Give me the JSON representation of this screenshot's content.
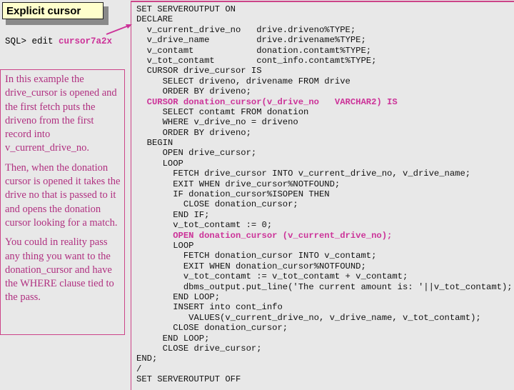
{
  "title": "Explicit cursor",
  "sql_command": {
    "prompt": "SQL> edit ",
    "file": "cursor7a2x"
  },
  "colors": {
    "accent": "#cc3399",
    "border": "#cc4488",
    "title_bg": "#ffffcc",
    "background": "#e8e8e8"
  },
  "explanation": [
    "In this example the drive_cursor is opened and the first fetch puts the driveno from the first record into v_current_drive_no.",
    "Then, when the donation cursor is opened it takes the drive no that is passed to it and opens the donation cursor looking for a match.",
    "You could in reality pass any thing you want to the donation_cursor and have the WHERE clause tied to the pass."
  ],
  "code_lines": [
    {
      "text": "SET SERVEROUTPUT ON",
      "highlight": false
    },
    {
      "text": "DECLARE",
      "highlight": false
    },
    {
      "text": "  v_current_drive_no   drive.driveno%TYPE;",
      "highlight": false
    },
    {
      "text": "  v_drive_name         drive.drivename%TYPE;",
      "highlight": false
    },
    {
      "text": "  v_contamt            donation.contamt%TYPE;",
      "highlight": false
    },
    {
      "text": "  v_tot_contamt        cont_info.contamt%TYPE;",
      "highlight": false
    },
    {
      "text": "  CURSOR drive_cursor IS",
      "highlight": false
    },
    {
      "text": "     SELECT driveno, drivename FROM drive",
      "highlight": false
    },
    {
      "text": "     ORDER BY driveno;",
      "highlight": false
    },
    {
      "text": "  CURSOR donation_cursor(v_drive_no   VARCHAR2) IS",
      "highlight": true
    },
    {
      "text": "     SELECT contamt FROM donation",
      "highlight": false
    },
    {
      "text": "     WHERE v_drive_no = driveno",
      "highlight": false
    },
    {
      "text": "     ORDER BY driveno;",
      "highlight": false
    },
    {
      "text": "  BEGIN",
      "highlight": false
    },
    {
      "text": "     OPEN drive_cursor;",
      "highlight": false
    },
    {
      "text": "     LOOP",
      "highlight": false
    },
    {
      "text": "       FETCH drive_cursor INTO v_current_drive_no, v_drive_name;",
      "highlight": false
    },
    {
      "text": "       EXIT WHEN drive_cursor%NOTFOUND;",
      "highlight": false
    },
    {
      "text": "       IF donation_cursor%ISOPEN THEN",
      "highlight": false
    },
    {
      "text": "         CLOSE donation_cursor;",
      "highlight": false
    },
    {
      "text": "       END IF;",
      "highlight": false
    },
    {
      "text": "       v_tot_contamt := 0;",
      "highlight": false
    },
    {
      "text": "       OPEN donation_cursor (v_current_drive_no);",
      "highlight": true
    },
    {
      "text": "       LOOP",
      "highlight": false
    },
    {
      "text": "         FETCH donation_cursor INTO v_contamt;",
      "highlight": false
    },
    {
      "text": "         EXIT WHEN donation_cursor%NOTFOUND;",
      "highlight": false
    },
    {
      "text": "         v_tot_contamt := v_tot_contamt + v_contamt;",
      "highlight": false
    },
    {
      "text": "         dbms_output.put_line('The current amount is: '||v_tot_contamt);",
      "highlight": false
    },
    {
      "text": "       END LOOP;",
      "highlight": false
    },
    {
      "text": "       INSERT into cont_info",
      "highlight": false
    },
    {
      "text": "          VALUES(v_current_drive_no, v_drive_name, v_tot_contamt);",
      "highlight": false
    },
    {
      "text": "       CLOSE donation_cursor;",
      "highlight": false
    },
    {
      "text": "     END LOOP;",
      "highlight": false
    },
    {
      "text": "     CLOSE drive_cursor;",
      "highlight": false
    },
    {
      "text": "END;",
      "highlight": false
    },
    {
      "text": "/",
      "highlight": false
    },
    {
      "text": "SET SERVEROUTPUT OFF",
      "highlight": false
    }
  ]
}
